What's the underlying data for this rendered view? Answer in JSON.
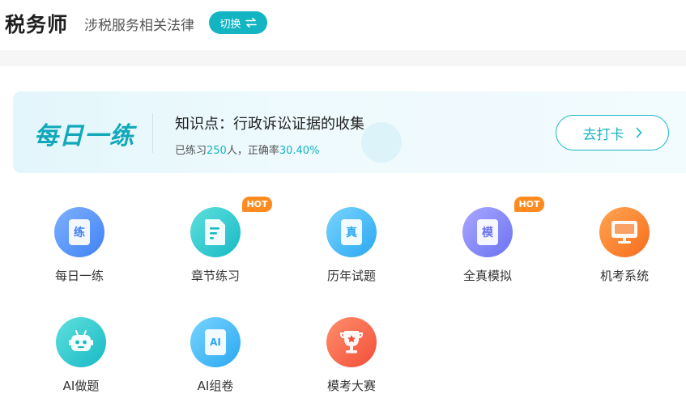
{
  "header": {
    "title": "税务师",
    "subtitle": "涉税服务相关法律",
    "switch_label": "切换"
  },
  "banner": {
    "logo_text": "每日一练",
    "topic": "知识点：行政诉讼证据的收集",
    "stats_prefix": "已练习",
    "practice_count": "250",
    "stats_mid": "人，正确率",
    "accuracy": "30.40%",
    "checkin_label": "去打卡"
  },
  "features": [
    {
      "label": "每日一练",
      "icon": "practice-icon",
      "glyph": "练",
      "hot": false
    },
    {
      "label": "章节练习",
      "icon": "chapter-doc-icon",
      "glyph": "",
      "hot": true
    },
    {
      "label": "历年试题",
      "icon": "past-exam-icon",
      "glyph": "真",
      "hot": false
    },
    {
      "label": "全真模拟",
      "icon": "mock-exam-icon",
      "glyph": "模",
      "hot": true
    },
    {
      "label": "机考系统",
      "icon": "computer-icon",
      "glyph": "",
      "hot": false
    },
    {
      "label": "AI做题",
      "icon": "robot-icon",
      "glyph": "",
      "hot": false
    },
    {
      "label": "AI组卷",
      "icon": "ai-paper-icon",
      "glyph": "AI",
      "hot": false
    },
    {
      "label": "模考大赛",
      "icon": "trophy-icon",
      "glyph": "",
      "hot": false
    }
  ],
  "hot_label": "HOT",
  "colors": {
    "accent": "#14b5c2",
    "hot": "#ff8a1f"
  }
}
